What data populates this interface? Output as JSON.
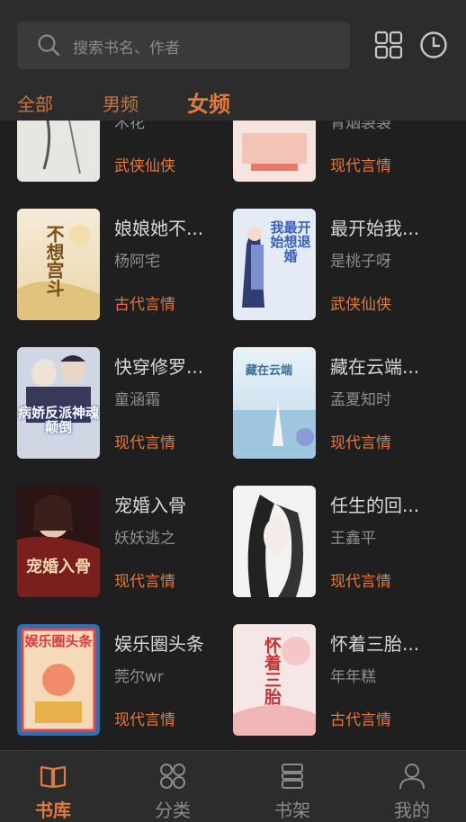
{
  "search": {
    "placeholder": "搜索书名、作者"
  },
  "header_icons": [
    "grid-icon",
    "history-clock-icon"
  ],
  "tabs": [
    {
      "label": "全部",
      "active": false
    },
    {
      "label": "男频",
      "active": false
    },
    {
      "label": "女频",
      "active": true
    }
  ],
  "books": [
    {
      "title": "",
      "author": "木花",
      "category": "武侠仙侠",
      "cover_text": ""
    },
    {
      "title": "",
      "author": "青烟袅袅",
      "category": "现代言情",
      "cover_text": ""
    },
    {
      "title": "娘娘她不...",
      "author": "杨阿宅",
      "category": "古代言情",
      "cover_text": "不想宫斗"
    },
    {
      "title": "最开始我...",
      "author": "是桃子呀",
      "category": "武侠仙侠",
      "cover_text": "我最开始想退婚"
    },
    {
      "title": "快穿修罗...",
      "author": "童涵霜",
      "category": "现代言情",
      "cover_text": "病娇反派神魂颠倒"
    },
    {
      "title": "藏在云端...",
      "author": "孟夏知时",
      "category": "现代言情",
      "cover_text": "藏在云端"
    },
    {
      "title": "宠婚入骨",
      "author": "妖妖逃之",
      "category": "现代言情",
      "cover_text": "宠婚入骨"
    },
    {
      "title": "任生的回...",
      "author": "王鑫平",
      "category": "现代言情",
      "cover_text": ""
    },
    {
      "title": "娱乐圈头条",
      "author": "莞尔wr",
      "category": "现代言情",
      "cover_text": "娱乐圈头条"
    },
    {
      "title": "怀着三胎...",
      "author": "年年糕",
      "category": "古代言情",
      "cover_text": "怀着三胎"
    }
  ],
  "nav": [
    {
      "label": "书库",
      "icon": "book-open-icon",
      "active": true
    },
    {
      "label": "分类",
      "icon": "category-grid-icon",
      "active": false
    },
    {
      "label": "书架",
      "icon": "bookshelf-icon",
      "active": false
    },
    {
      "label": "我的",
      "icon": "user-icon",
      "active": false
    }
  ],
  "colors": {
    "accent": "#e2793f",
    "background": "#1f1f1f",
    "bar": "#2c2c2c"
  }
}
